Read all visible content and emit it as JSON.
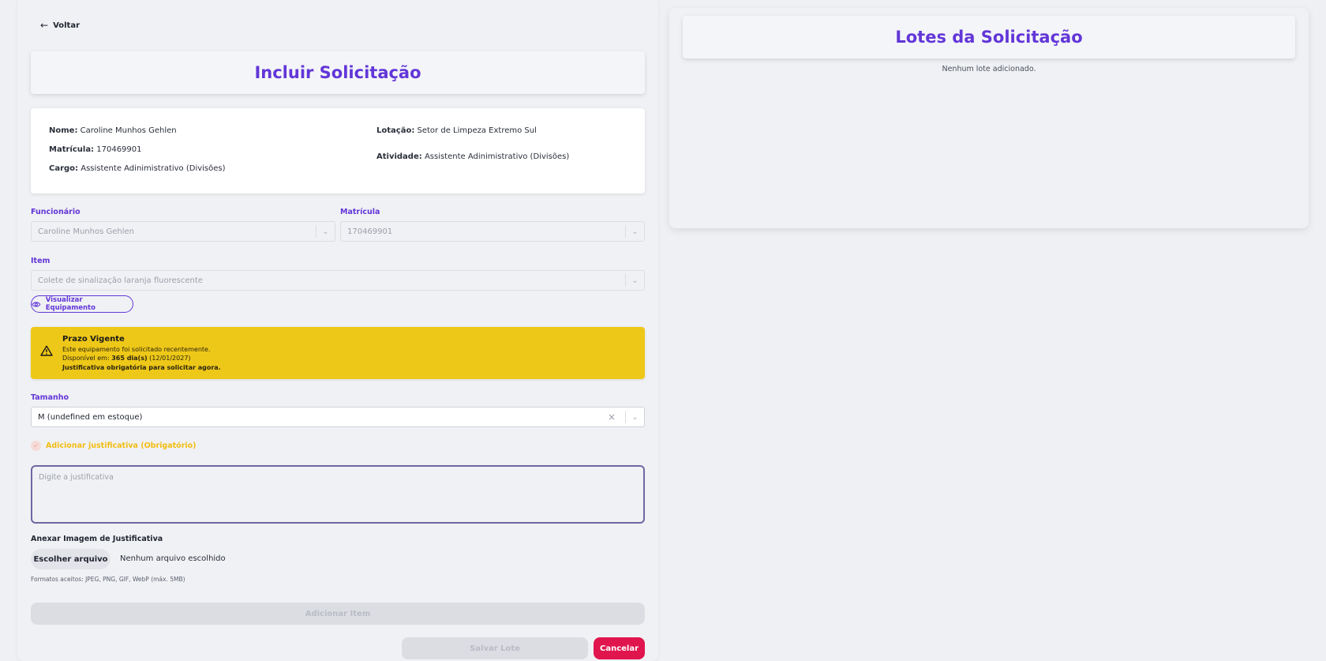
{
  "back": {
    "label": "Voltar"
  },
  "form": {
    "title": "Incluir Solicitação",
    "info": {
      "nome_label": "Nome:",
      "nome_value": "Caroline Munhos Gehlen",
      "matricula_label": "Matrícula:",
      "matricula_value": "170469901",
      "cargo_label": "Cargo:",
      "cargo_value": "Assistente Adinimistrativo (Divisões)",
      "lotacao_label": "Lotação:",
      "lotacao_value": "Setor de Limpeza Extremo Sul",
      "atividade_label": "Atividade:",
      "atividade_value": "Assistente Adinimistrativo (Divisões)"
    },
    "funcionario": {
      "label": "Funcionário",
      "value": "Caroline Munhos Gehlen"
    },
    "matricula": {
      "label": "Matrícula",
      "value": "170469901"
    },
    "item": {
      "label": "Item",
      "value": "Colete de sinalização laranja fluorescente"
    },
    "view_button": "Visualizar Equipamento",
    "warning": {
      "title": "Prazo Vigente",
      "line1": "Este equipamento foi solicitado recentemente.",
      "line2_prefix": "Disponível em: ",
      "line2_bold": "365 dia(s)",
      "line2_suffix": " (12/01/2027)",
      "line3": "Justificativa obrigatória para solicitar agora.",
      "color": "#eec818"
    },
    "tamanho": {
      "label": "Tamanho",
      "value": "M (undefined em estoque)"
    },
    "justificativa_checkbox": "Adicionar justificativa (Obrigatório)",
    "justificativa_placeholder": "Digite a justificativa",
    "attach": {
      "label": "Anexar Imagem de Justificativa",
      "button": "Escolher arquivo",
      "status": "Nenhum arquivo escolhido",
      "formats": "Formatos aceitos: JPEG, PNG, GIF, WebP (máx. 5MB)"
    },
    "add_item": "Adicionar Item",
    "save_lote": "Salvar Lote",
    "cancel": "Cancelar",
    "accent_color": "#6236d8",
    "danger_color": "#e0154e"
  },
  "lotes": {
    "title": "Lotes da Solicitação",
    "empty": "Nenhum lote adicionado."
  }
}
